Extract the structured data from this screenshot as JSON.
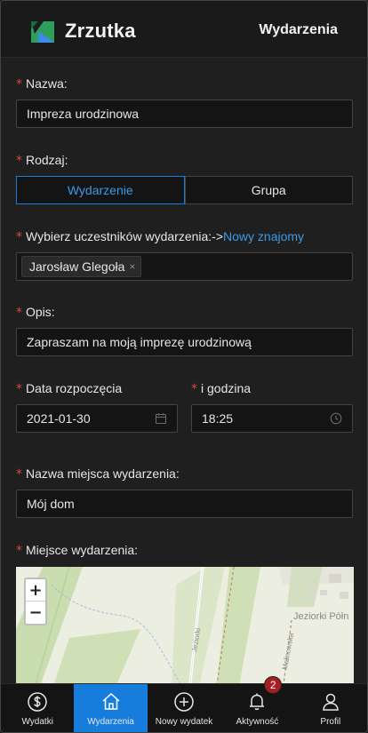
{
  "header": {
    "app_title": "Zrzutka",
    "page_title": "Wydarzenia",
    "logo_icon": "zrzutka-logo-icon"
  },
  "form": {
    "name": {
      "label": "Nazwa:",
      "value": "Impreza urodzinowa"
    },
    "type": {
      "label": "Rodzaj:",
      "options": [
        "Wydarzenie",
        "Grupa"
      ],
      "selected": "Wydarzenie"
    },
    "participants": {
      "label": "Wybierz uczestników wydarzenia:->",
      "link": "Nowy znajomy",
      "tags": [
        "Jarosław Glegoła"
      ],
      "tag_close": "×"
    },
    "description": {
      "label": "Opis:",
      "value": "Zapraszam na moją imprezę urodzinową"
    },
    "start_date": {
      "label": "Data rozpoczęcia",
      "value": "2021-01-30",
      "icon": "calendar-icon"
    },
    "start_time": {
      "label": "i godzina",
      "value": "18:25",
      "icon": "clock-icon"
    },
    "place_name": {
      "label": "Nazwa miejsca wydarzenia:",
      "value": "Mój dom"
    },
    "place": {
      "label": "Miejsce wydarzenia:"
    },
    "required_mark": "*"
  },
  "map": {
    "zoom_in": "+",
    "zoom_out": "−",
    "place_label": "Jeziorki Półn",
    "street_label_1": "Jeziorki",
    "street_label_2": "Malinowska"
  },
  "nav": {
    "items": [
      {
        "label": "Wydatki",
        "icon": "dollar-icon"
      },
      {
        "label": "Wydarzenia",
        "icon": "home-icon"
      },
      {
        "label": "Nowy wydatek",
        "icon": "plus-circle-icon"
      },
      {
        "label": "Aktywność",
        "icon": "bell-icon",
        "badge": "2"
      },
      {
        "label": "Profil",
        "icon": "user-icon"
      }
    ],
    "active": "Wydarzenia"
  },
  "colors": {
    "accent": "#177ddc",
    "link": "#3c9ae8",
    "required": "#e0453a",
    "badge": "#a61d24",
    "background": "#1f1f1f"
  }
}
